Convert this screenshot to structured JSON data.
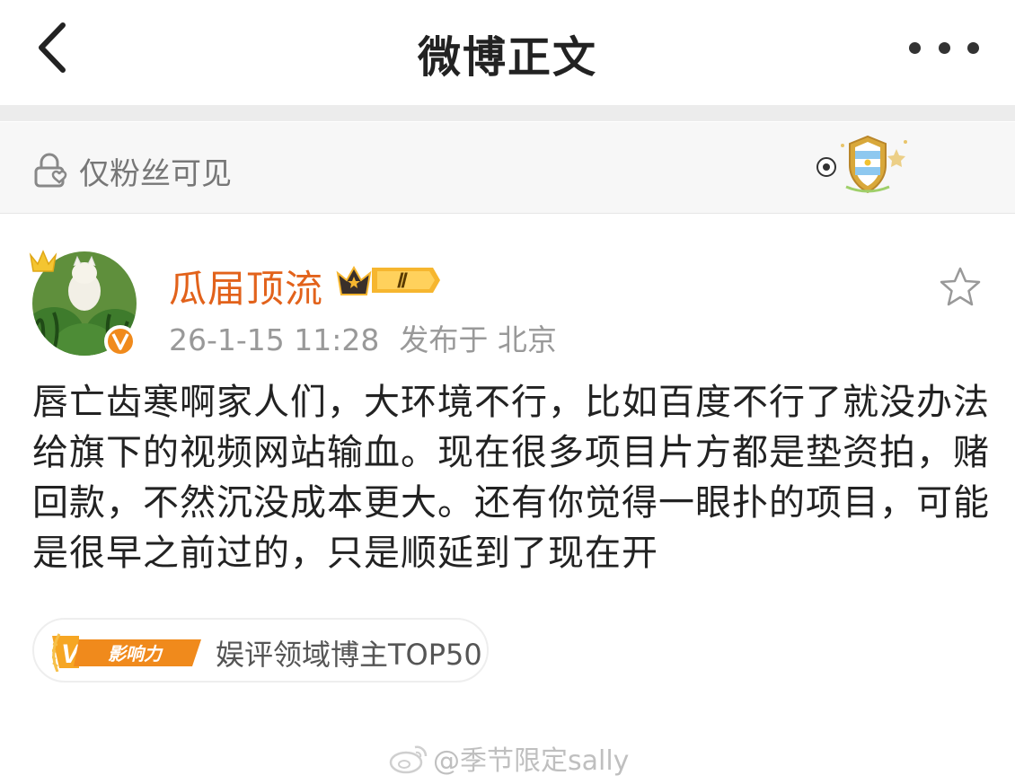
{
  "nav": {
    "title": "微博正文",
    "back_icon": "chevron-left-icon",
    "more_icon": "more-horizontal-icon"
  },
  "visibility": {
    "icon": "lock-heart-icon",
    "label": "仅粉丝可见",
    "badge_icon": "argentina-shield-badge"
  },
  "author": {
    "name": "瓜届顶流",
    "name_color": "#e2621b",
    "member_badge": "crown-vip-badge",
    "member_level": "Ⅱ",
    "verified_icon": "verified-v-icon",
    "timestamp": "26-1-15 11:28",
    "location": "发布于 北京"
  },
  "post": {
    "text": "唇亡齿寒啊家人们，大环境不行，比如百度不行了就没办法给旗下的视频网站输血。现在很多项目片方都是垫资拍，赌回款，不然沉没成本更大。还有你觉得一眼扑的项目，可能是很早之前过的，只是顺延到了现在开",
    "favorite_icon": "star-outline-icon"
  },
  "influence": {
    "logo_letter": "V",
    "logo_text": "影响力",
    "label": "娱评领域博主TOP50",
    "accent": "#f08a1c"
  },
  "watermark": {
    "icon": "weibo-logo-icon",
    "text": "@季节限定sally"
  }
}
